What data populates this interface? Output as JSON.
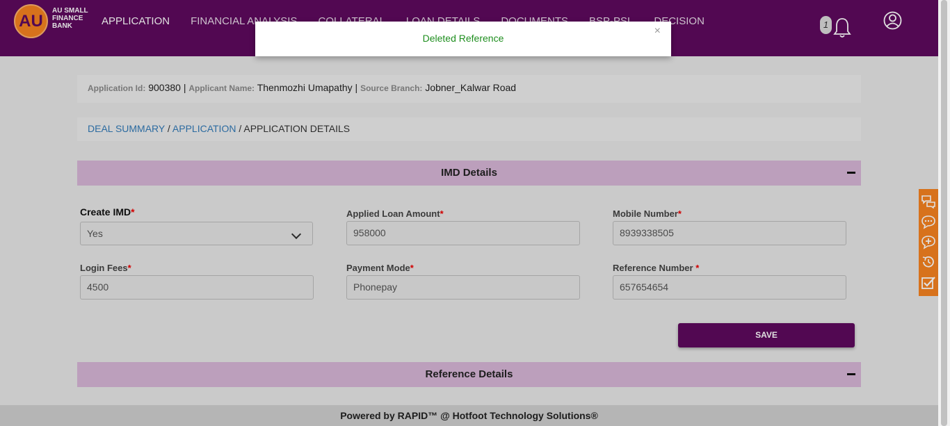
{
  "brand": {
    "mark": "AU",
    "name": "AU SMALL FINANCE BANK"
  },
  "nav": [
    "APPLICATION",
    "FINANCIAL ANALYSIS",
    "COLLATERAL",
    "LOAN DETAILS",
    "DOCUMENTS",
    "BSP-PSL",
    "DECISION"
  ],
  "header": {
    "user_badge": "1",
    "bell_icon": "bell-icon",
    "profile_icon": "user-circle-icon"
  },
  "toast": {
    "message": "Deleted Reference",
    "close": "×"
  },
  "info": {
    "app_id_label": "Application Id:",
    "app_id": "900380",
    "applicant_label": "Applicant Name:",
    "applicant": "Thenmozhi Umapathy",
    "branch_label": "Source Branch:",
    "branch": "Jobner_Kalwar Road",
    "sep": "|"
  },
  "breadcrumb": {
    "item1": "DEAL SUMMARY",
    "item2": "APPLICATION",
    "current": "APPLICATION DETAILS",
    "sep": "/"
  },
  "imd": {
    "title": "IMD Details",
    "create_imd": {
      "label": "Create IMD",
      "value": "Yes"
    },
    "loan_amount": {
      "label": "Applied Loan Amount",
      "value": "958000"
    },
    "mobile": {
      "label": "Mobile Number",
      "value": "8939338505"
    },
    "login_fees": {
      "label": "Login Fees",
      "value": "4500"
    },
    "payment_mode": {
      "label": "Payment Mode",
      "value": "Phonepay"
    },
    "reference": {
      "label": "Reference Number ",
      "value": "657654654"
    },
    "required_mark": "*",
    "save": "SAVE"
  },
  "reference_section": {
    "title": "Reference Details"
  },
  "footer": {
    "text": "Powered by RAPID™ @ Hotfoot Technology Solutions®"
  },
  "side_tools": [
    "comments-icon",
    "chat-icon",
    "add-comment-icon",
    "history-icon",
    "checklist-icon"
  ],
  "colors": {
    "primary": "#5e0a5e",
    "accent": "#f58220",
    "section": "#d7b6d7",
    "success": "#1e8e1e"
  }
}
